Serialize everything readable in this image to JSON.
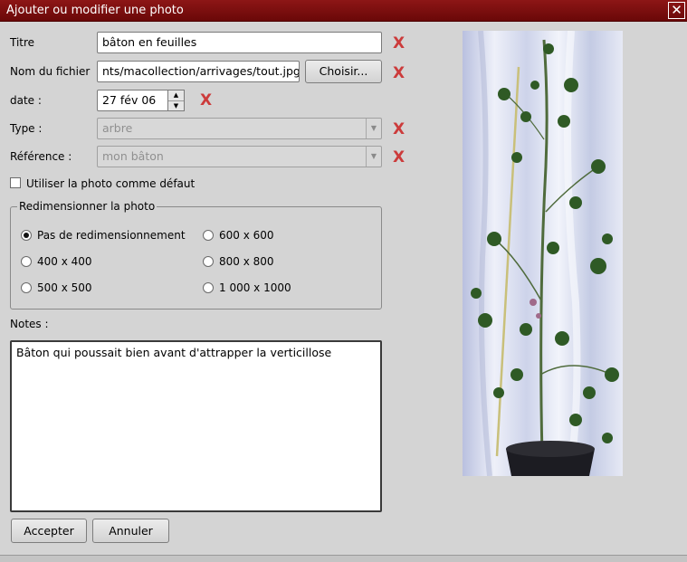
{
  "window": {
    "title": "Ajouter ou modifier une photo"
  },
  "form": {
    "titre_label": "Titre",
    "titre_value": "bâton en feuilles",
    "fichier_label": "Nom du fichier",
    "fichier_value": "nts/macollection/arrivages/tout.jpg",
    "choisir_label": "Choisir...",
    "date_label": "date :",
    "date_value": "27 fév 06",
    "type_label": "Type :",
    "type_value": "arbre",
    "reference_label": "Référence :",
    "reference_value": "mon bâton",
    "default_label": "Utiliser la photo comme défaut",
    "default_checked": false,
    "clear_symbol": "X"
  },
  "resize": {
    "legend": "Redimensionner la photo",
    "options": [
      {
        "label": "Pas de redimensionnement",
        "selected": true
      },
      {
        "label": "400 x 400",
        "selected": false
      },
      {
        "label": "500 x 500",
        "selected": false
      },
      {
        "label": "600 x 600",
        "selected": false
      },
      {
        "label": "800 x 800",
        "selected": false
      },
      {
        "label": "1 000 x 1000",
        "selected": false
      }
    ]
  },
  "notes": {
    "label": "Notes :",
    "value": "Bâton qui poussait bien avant d'attrapper la verticillose"
  },
  "buttons": {
    "accept": "Accepter",
    "cancel": "Annuler"
  },
  "colors": {
    "titlebar": "#7a0c0c",
    "clear_mark": "#cc3b3b"
  }
}
